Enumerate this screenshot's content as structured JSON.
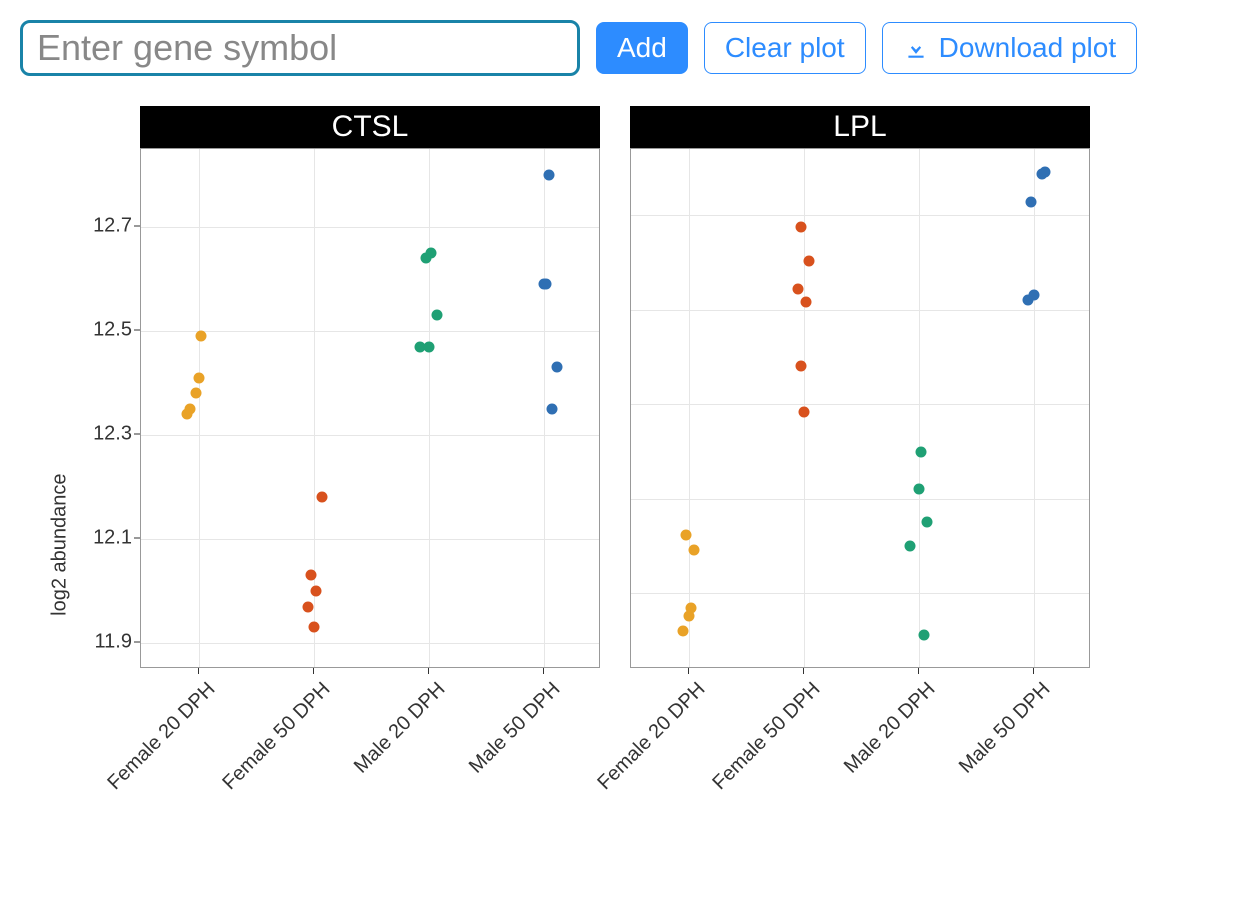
{
  "toolbar": {
    "input_placeholder": "Enter gene symbol",
    "input_value": "",
    "add_label": "Add",
    "clear_label": "Clear plot",
    "download_label": "Download plot"
  },
  "y_axis_label": "log2 abundance",
  "categories": [
    "Female 20 DPH",
    "Female 50 DPH",
    "Male 20 DPH",
    "Male 50 DPH"
  ],
  "colors": {
    "Female 20 DPH": "#e9a227",
    "Female 50 DPH": "#d8511d",
    "Male 20 DPH": "#1fa074",
    "Male 50 DPH": "#2f6fb3"
  },
  "chart_data": [
    {
      "type": "scatter",
      "title": "CTSL",
      "xlabel": "",
      "ylabel": "log2 abundance",
      "ylim": [
        11.85,
        12.85
      ],
      "yticks": [
        11.9,
        12.1,
        12.3,
        12.5,
        12.7
      ],
      "categories": [
        "Female 20 DPH",
        "Female 50 DPH",
        "Male 20 DPH",
        "Male 50 DPH"
      ],
      "series": [
        {
          "name": "Female 20 DPH",
          "x": [
            -0.08,
            -0.06,
            -0.02,
            0.0,
            0.02
          ],
          "values": [
            12.34,
            12.35,
            12.38,
            12.41,
            12.49
          ]
        },
        {
          "name": "Female 50 DPH",
          "x": [
            0.0,
            -0.04,
            0.02,
            -0.02,
            0.06
          ],
          "values": [
            11.93,
            11.97,
            12.0,
            12.03,
            12.18
          ]
        },
        {
          "name": "Male 20 DPH",
          "x": [
            -0.06,
            0.0,
            -0.02,
            0.02,
            0.06
          ],
          "values": [
            12.47,
            12.47,
            12.64,
            12.65,
            12.53
          ]
        },
        {
          "name": "Male 50 DPH",
          "x": [
            0.06,
            0.1,
            0.0,
            0.02,
            0.04
          ],
          "values": [
            12.35,
            12.43,
            12.59,
            12.59,
            12.8
          ]
        }
      ],
      "x_jitter_note": "x offsets are visual jitter within category (range ~[-0.12,0.12])"
    },
    {
      "type": "scatter",
      "title": "LPL",
      "xlabel": "",
      "ylabel": "log2 abundance",
      "ylim": [
        9.6,
        12.35
      ],
      "yticks": [
        10.0,
        10.5,
        11.0,
        11.5,
        12.0
      ],
      "categories": [
        "Female 20 DPH",
        "Female 50 DPH",
        "Male 20 DPH",
        "Male 50 DPH"
      ],
      "series": [
        {
          "name": "Female 20 DPH",
          "x": [
            -0.04,
            0.0,
            0.02,
            -0.02,
            0.04
          ],
          "values": [
            9.8,
            9.88,
            9.92,
            10.31,
            10.23
          ]
        },
        {
          "name": "Female 50 DPH",
          "x": [
            0.0,
            -0.02,
            0.02,
            -0.04,
            0.04,
            -0.02
          ],
          "values": [
            10.96,
            11.2,
            11.54,
            11.61,
            11.76,
            11.94
          ]
        },
        {
          "name": "Male 20 DPH",
          "x": [
            0.04,
            -0.06,
            0.0,
            0.06,
            0.02
          ],
          "values": [
            9.78,
            10.25,
            10.55,
            10.38,
            10.75
          ]
        },
        {
          "name": "Male 50 DPH",
          "x": [
            -0.04,
            0.0,
            -0.02,
            0.06,
            0.08
          ],
          "values": [
            11.55,
            11.58,
            12.07,
            12.22,
            12.23
          ]
        }
      ],
      "x_jitter_note": "x offsets are visual jitter within category (range ~[-0.12,0.12])"
    }
  ]
}
